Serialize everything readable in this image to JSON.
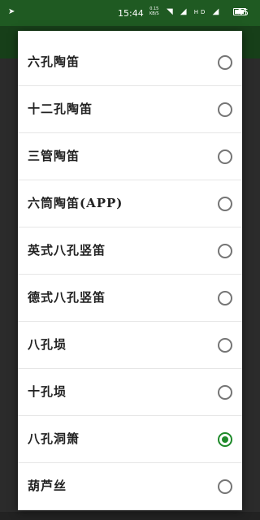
{
  "status_bar": {
    "time": "15:44",
    "net_speed_value": "0.15",
    "net_speed_unit": "KB/S",
    "hd_badge": "HD",
    "battery_percent": "95"
  },
  "dialog": {
    "options": [
      {
        "label": "六孔陶笛",
        "selected": false
      },
      {
        "label": "十二孔陶笛",
        "selected": false
      },
      {
        "label": "三管陶笛",
        "selected": false
      },
      {
        "label": "六筒陶笛(APP)",
        "selected": false
      },
      {
        "label": "英式八孔竖笛",
        "selected": false
      },
      {
        "label": "德式八孔竖笛",
        "selected": false
      },
      {
        "label": "八孔埙",
        "selected": false
      },
      {
        "label": "十孔埙",
        "selected": false
      },
      {
        "label": "八孔洞箫",
        "selected": true
      },
      {
        "label": "葫芦丝",
        "selected": false
      }
    ],
    "accent_color": "#1e8a2a"
  }
}
